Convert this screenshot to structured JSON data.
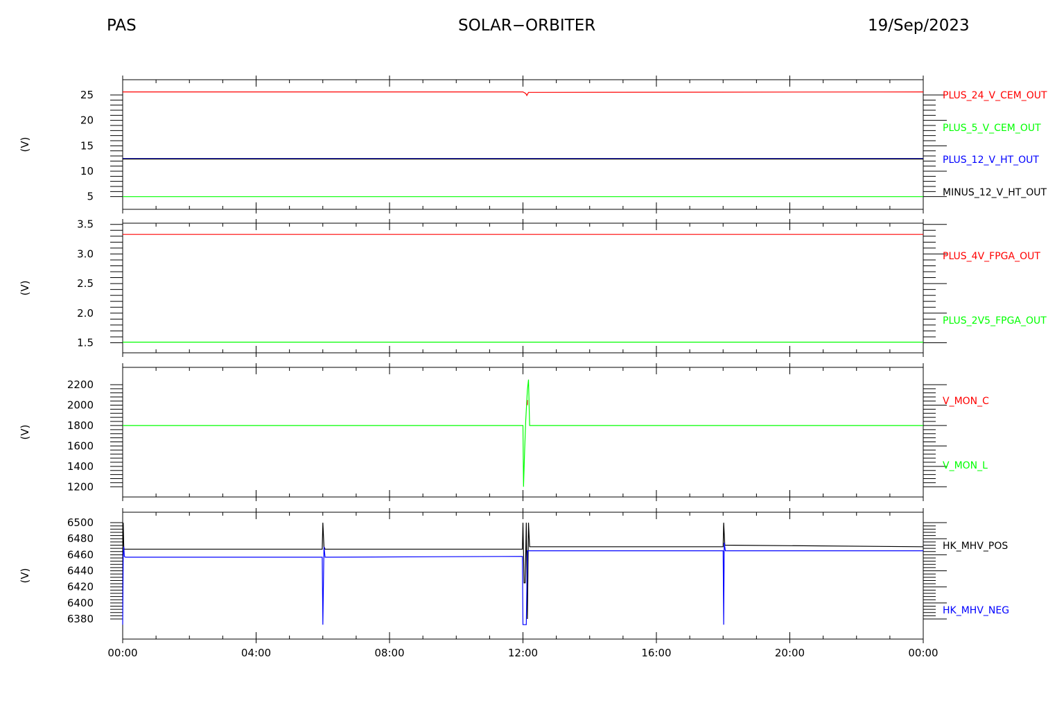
{
  "header": {
    "left": "PAS",
    "center": "SOLAR−ORBITER",
    "right": "19/Sep/2023"
  },
  "chart_data": [
    {
      "type": "line",
      "ylabel": "(V)",
      "ylim": [
        2.5,
        28
      ],
      "yticks": [
        5,
        10,
        15,
        20,
        25
      ],
      "yticklabels": [
        "5",
        "10",
        "15",
        "20",
        "25"
      ],
      "x_time": [
        "00:00",
        "04:00",
        "08:00",
        "12:00",
        "16:00",
        "20:00",
        "00:00"
      ],
      "series": [
        {
          "name": "PLUS_24_V_CEM_OUT",
          "color": "#ff0000",
          "x": [
            "00:00",
            "12:00",
            "12:05",
            "12:07",
            "12:10",
            "24:00"
          ],
          "y": [
            25.6,
            25.6,
            25.3,
            24.9,
            25.5,
            25.6
          ]
        },
        {
          "name": "PLUS_5_V_CEM_OUT",
          "color": "#00ff00",
          "x": [
            "00:00",
            "24:00"
          ],
          "y": [
            5.0,
            5.0
          ]
        },
        {
          "name": "PLUS_12_V_HT_OUT",
          "color": "#0000ff",
          "x": [
            "00:00",
            "24:00"
          ],
          "y": [
            12.5,
            12.5
          ]
        },
        {
          "name": "MINUS_12_V_HT_OUT",
          "color": "#000000",
          "x": [
            "00:00",
            "24:00"
          ],
          "y": [
            12.4,
            12.4
          ]
        }
      ]
    },
    {
      "type": "line",
      "ylabel": "(V)",
      "ylim": [
        1.33,
        3.52
      ],
      "yticks": [
        1.5,
        2.0,
        2.5,
        3.0,
        3.5
      ],
      "yticklabels": [
        "1.5",
        "2.0",
        "2.5",
        "3.0",
        "3.5"
      ],
      "x_time": [
        "00:00",
        "04:00",
        "08:00",
        "12:00",
        "16:00",
        "20:00",
        "00:00"
      ],
      "series": [
        {
          "name": "PLUS_4V_FPGA_OUT",
          "color": "#ff0000",
          "x": [
            "00:00",
            "24:00"
          ],
          "y": [
            3.33,
            3.33
          ]
        },
        {
          "name": "PLUS_2V5_FPGA_OUT",
          "color": "#00ff00",
          "x": [
            "00:00",
            "24:00"
          ],
          "y": [
            1.51,
            1.51
          ]
        }
      ]
    },
    {
      "type": "line",
      "ylabel": "(V)",
      "ylim": [
        1100,
        2370
      ],
      "yticks": [
        1200,
        1400,
        1600,
        1800,
        2000,
        2200
      ],
      "yticklabels": [
        "1200",
        "1400",
        "1600",
        "1800",
        "2000",
        "2200"
      ],
      "x_time": [
        "00:00",
        "04:00",
        "08:00",
        "12:00",
        "16:00",
        "20:00",
        "00:00"
      ],
      "series": [
        {
          "name": "V_MON_C",
          "color": "#ff0000",
          "x": [
            "12:08",
            "12:08"
          ],
          "y": [
            2000,
            2050
          ]
        },
        {
          "name": "V_MON_L",
          "color": "#00ff00",
          "x": [
            "00:00",
            "12:00",
            "12:01",
            "12:03",
            "12:05",
            "12:08",
            "12:10",
            "12:12",
            "24:00"
          ],
          "y": [
            1800,
            1800,
            1200,
            1550,
            1850,
            2150,
            2250,
            1800,
            1800
          ]
        }
      ]
    },
    {
      "type": "line",
      "ylabel": "(V)",
      "ylim": [
        6355,
        6513
      ],
      "yticks": [
        6380,
        6400,
        6420,
        6440,
        6460,
        6480,
        6500
      ],
      "yticklabels": [
        "6380",
        "6400",
        "6420",
        "6440",
        "6460",
        "6480",
        "6500"
      ],
      "x_time": [
        "00:00",
        "04:00",
        "08:00",
        "12:00",
        "16:00",
        "20:00",
        "00:00"
      ],
      "series": [
        {
          "name": "HK_MHV_POS",
          "color": "#000000",
          "x": [
            "00:00",
            "00:01",
            "00:02",
            "00:03",
            "00:05",
            "05:59",
            "06:00",
            "06:02",
            "06:04",
            "11:59",
            "12:00",
            "12:02",
            "12:04",
            "12:06",
            "12:08",
            "12:10",
            "12:12",
            "18:00",
            "18:01",
            "18:03",
            "24:00"
          ],
          "y": [
            6465,
            6500,
            6468,
            6467,
            6467,
            6467,
            6500,
            6470,
            6467,
            6467,
            6500,
            6425,
            6425,
            6500,
            6380,
            6500,
            6470,
            6470,
            6500,
            6472,
            6470
          ]
        },
        {
          "name": "HK_MHV_NEG",
          "color": "#0000ff",
          "x": [
            "00:00",
            "00:01",
            "00:02",
            "00:03",
            "00:05",
            "05:59",
            "06:00",
            "06:02",
            "06:04",
            "11:59",
            "12:00",
            "12:02",
            "12:06",
            "12:08",
            "12:10",
            "12:12",
            "18:00",
            "18:01",
            "18:02",
            "18:04",
            "24:00"
          ],
          "y": [
            6373,
            6460,
            6470,
            6458,
            6457,
            6457,
            6373,
            6470,
            6457,
            6458,
            6373,
            6373,
            6373,
            6465,
            6465,
            6465,
            6465,
            6373,
            6475,
            6465,
            6465
          ]
        }
      ]
    }
  ]
}
